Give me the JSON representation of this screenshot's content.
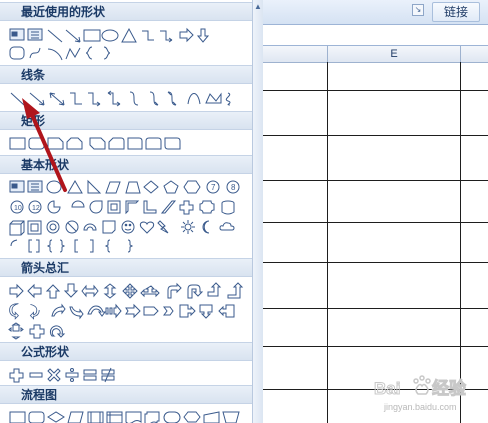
{
  "ribbon": {
    "link_label": "链接",
    "launcher_icon": "dialog-launcher-icon"
  },
  "sheet": {
    "columns": [
      "",
      "E",
      ""
    ]
  },
  "gallery": {
    "sections": [
      {
        "label": "最近使用的形状",
        "shapes": [
          "text-box",
          "vertical-text-box",
          "line",
          "arrow",
          "rectangle",
          "oval",
          "triangle",
          "elbow-connector",
          "elbow-arrow-connector",
          "right-arrow",
          "down-arrow",
          "rounded-rectangle",
          "curve",
          "arc",
          "freeform",
          "left-brace",
          "right-brace"
        ]
      },
      {
        "label": "线条",
        "shapes": [
          "line",
          "arrow",
          "double-arrow",
          "elbow-connector",
          "elbow-arrow-connector",
          "elbow-double-arrow-connector",
          "curved-connector",
          "curved-arrow-connector",
          "curved-double-arrow-connector",
          "curve",
          "freeform",
          "scribble"
        ]
      },
      {
        "label": "矩形",
        "shapes": [
          "rectangle",
          "rounded-rectangle",
          "snip-single-corner",
          "snip-same-side",
          "snip-diagonal",
          "snip-round",
          "round-single-corner",
          "round-same-side",
          "round-diagonal"
        ]
      },
      {
        "label": "基本形状",
        "shapes": [
          "text-box",
          "vertical-text-box",
          "oval",
          "triangle",
          "right-triangle",
          "parallelogram",
          "trapezoid",
          "diamond",
          "pentagon",
          "hexagon",
          "heptagon",
          "octagon",
          "decagon",
          "dodecagon",
          "pie",
          "chord",
          "teardrop",
          "frame",
          "half-frame",
          "l-shape",
          "diagonal-stripe",
          "cross",
          "plaque",
          "can",
          "cube",
          "bevel",
          "donut",
          "no-symbol",
          "block-arc",
          "folded-corner",
          "smiley-face",
          "heart",
          "lightning-bolt",
          "sun",
          "moon",
          "cloud",
          "arc",
          "double-bracket",
          "double-brace",
          "left-bracket",
          "right-bracket",
          "left-brace",
          "right-brace"
        ]
      },
      {
        "label": "箭头总汇",
        "shapes": [
          "right-arrow",
          "left-arrow",
          "up-arrow",
          "down-arrow",
          "left-right-arrow",
          "up-down-arrow",
          "quad-arrow",
          "left-right-up-arrow",
          "bent-arrow",
          "u-turn-arrow",
          "left-up-arrow",
          "bent-up-arrow",
          "curved-right-arrow",
          "curved-left-arrow",
          "curved-up-arrow",
          "curved-down-arrow",
          "striped-right-arrow",
          "notched-right-arrow",
          "pentagon-arrow",
          "chevron",
          "right-arrow-callout",
          "down-arrow-callout",
          "left-arrow-callout",
          "up-arrow-callout",
          "left-right-arrow-callout",
          "quad-arrow-callout",
          "circular-arrow"
        ]
      },
      {
        "label": "公式形状",
        "shapes": [
          "plus",
          "minus",
          "multiply",
          "divide",
          "equal",
          "not-equal"
        ]
      },
      {
        "label": "流程图",
        "shapes": [
          "process",
          "alternate-process",
          "decision",
          "data",
          "predefined-process",
          "internal-storage",
          "document",
          "multidocument",
          "terminator",
          "preparation",
          "manual-input",
          "manual-operation"
        ]
      }
    ]
  },
  "annotation": {
    "arrow_color": "#b0151c"
  },
  "watermark": {
    "url": "jingyan.baidu.com"
  }
}
